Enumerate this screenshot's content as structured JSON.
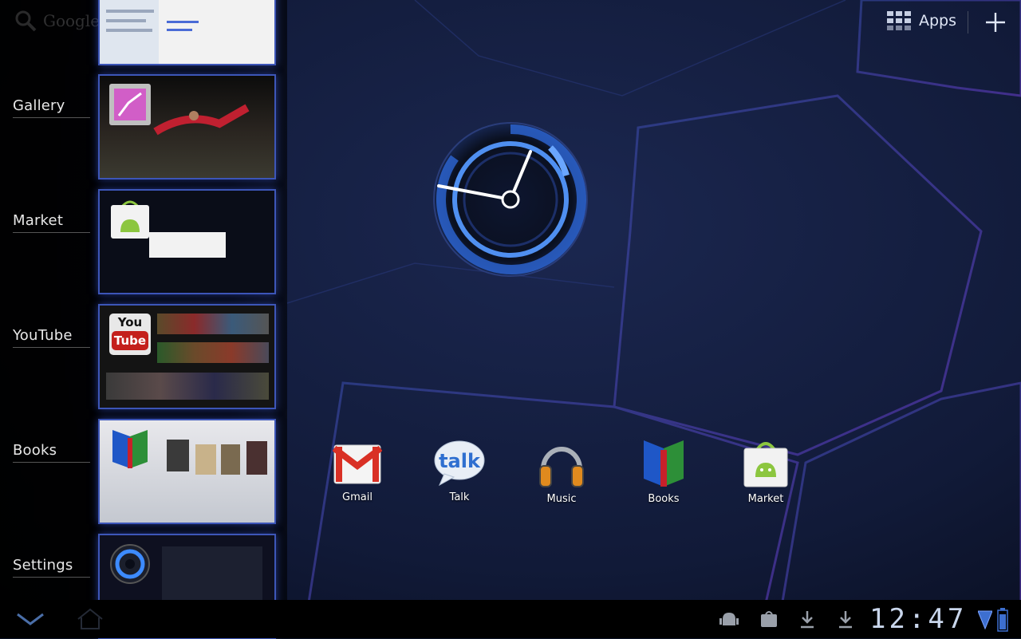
{
  "search": {
    "label": "Google"
  },
  "recents": [
    {
      "label": "",
      "app": "browser"
    },
    {
      "label": "Gallery",
      "app": "gallery"
    },
    {
      "label": "Market",
      "app": "market"
    },
    {
      "label": "YouTube",
      "app": "youtube"
    },
    {
      "label": "Books",
      "app": "books"
    },
    {
      "label": "Settings",
      "app": "settings"
    }
  ],
  "youtube_icon": {
    "line1": "You",
    "line2": "Tube"
  },
  "top_bar": {
    "apps_label": "Apps",
    "add_icon": "plus-icon",
    "apps_icon": "apps-grid-icon"
  },
  "dock": [
    {
      "label": "Gmail",
      "icon": "gmail-icon"
    },
    {
      "label": "Talk",
      "icon": "talk-icon"
    },
    {
      "label": "Music",
      "icon": "music-icon"
    },
    {
      "label": "Books",
      "icon": "books-icon"
    },
    {
      "label": "Market",
      "icon": "market-icon"
    }
  ],
  "talk_icon_text": "talk",
  "system_bar": {
    "time": "12:47"
  },
  "colors": {
    "accent": "#3d8bff",
    "wallpaper": "#0b1226",
    "thumb_border": "#3d56b8"
  }
}
